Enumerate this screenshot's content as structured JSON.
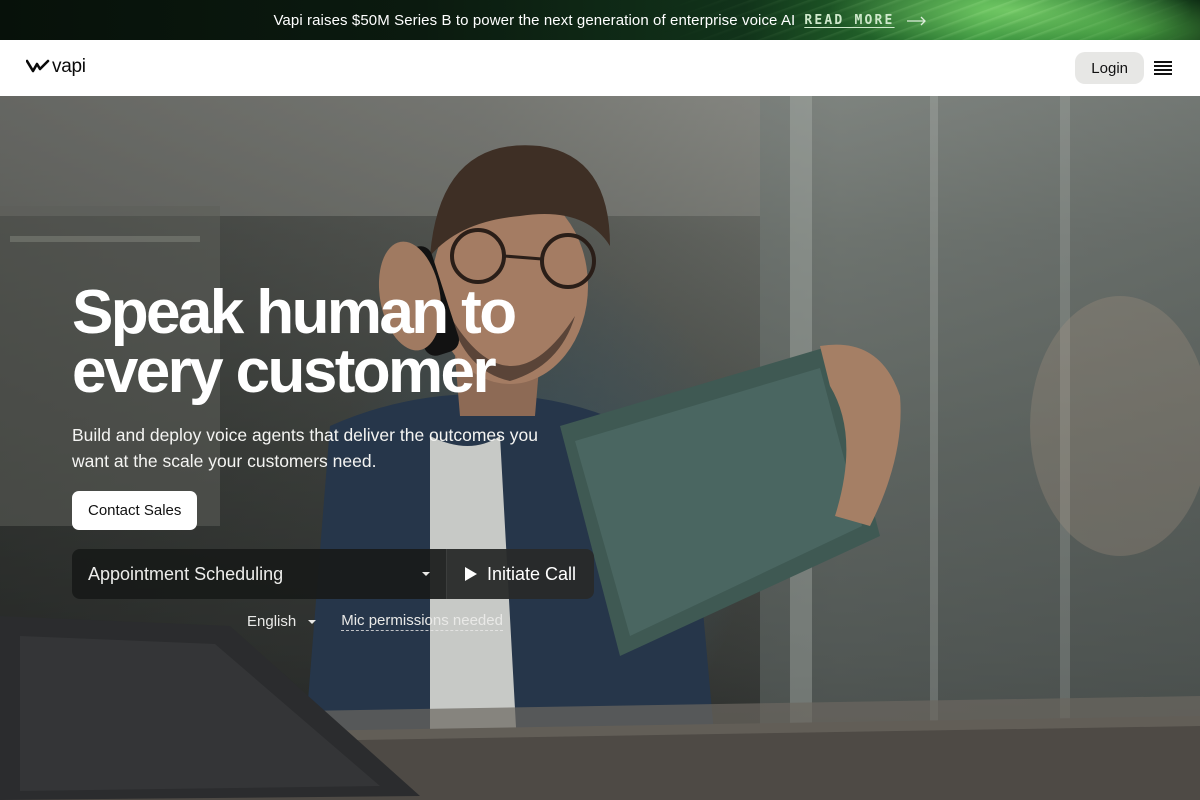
{
  "announcement": {
    "message": "Vapi raises $50M Series B to power the next generation of enterprise voice AI",
    "link_label": "READ MORE",
    "arrow_icon": "long-arrow-right-icon"
  },
  "nav": {
    "logo_text": "vapi",
    "logo_icon": "vapi-wave-icon",
    "login_label": "Login",
    "menu_icon": "hamburger-menu-icon"
  },
  "hero": {
    "title_line1": "Speak human to",
    "title_line2": "every customer",
    "subtitle": "Build and deploy voice agents that deliver the outcomes you want at the scale your customers need.",
    "contact_label": "Contact Sales",
    "background_image": "man-on-phone-holding-tablet-photo"
  },
  "demo": {
    "scenario_selected": "Appointment Scheduling",
    "initiate_label": "Initiate Call",
    "language_selected": "English",
    "mic_status": "Mic permissions needed"
  },
  "colors": {
    "announce_accent": "#2f8a36",
    "nav_bg": "#ffffff",
    "login_bg": "#e7e7e5",
    "demo_bg": "#181a19"
  }
}
